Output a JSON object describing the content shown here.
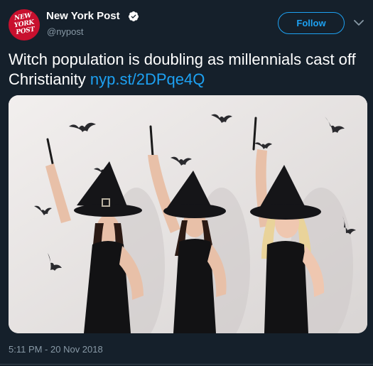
{
  "account": {
    "avatar_logo_text": "NEW YORK POST",
    "display_name": "New York Post",
    "handle": "@nypost",
    "verified": true
  },
  "follow_button": {
    "label": "Follow"
  },
  "more_menu": {
    "icon": "chevron-down-icon"
  },
  "tweet": {
    "text": "Witch population is doubling as millennials cast off Christianity ",
    "link": "nyp.st/2DPqe4Q",
    "timestamp": "5:11 PM - 20 Nov 2018"
  },
  "media": {
    "description_icon": "photo-three-witches"
  },
  "colors": {
    "background": "#15202b",
    "accent": "#1da1f2",
    "secondary_text": "#8899a6",
    "brand_red": "#c8102e"
  }
}
